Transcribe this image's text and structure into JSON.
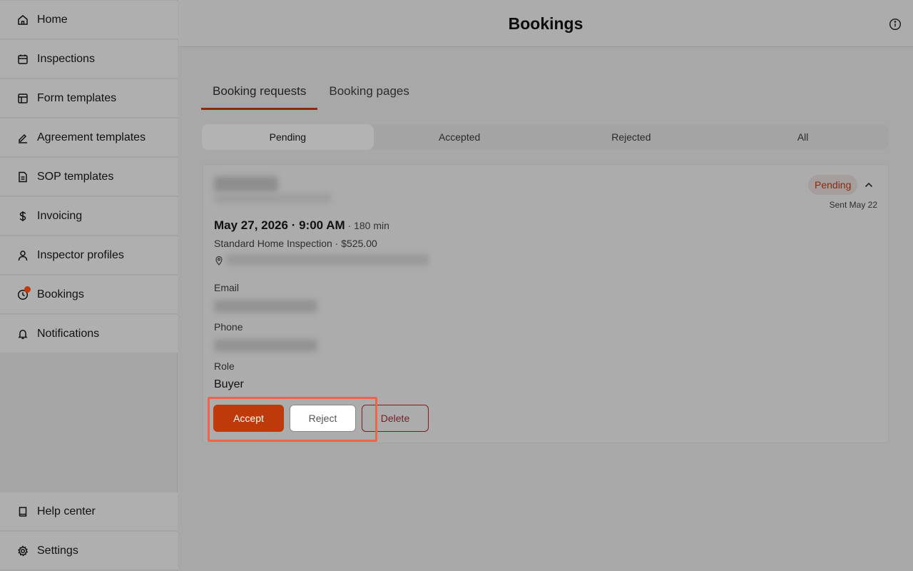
{
  "sidebar": {
    "items": [
      {
        "label": "Home",
        "icon": "home-icon"
      },
      {
        "label": "Inspections",
        "icon": "calendar-icon"
      },
      {
        "label": "Form templates",
        "icon": "layout-icon"
      },
      {
        "label": "Agreement templates",
        "icon": "signature-icon"
      },
      {
        "label": "SOP templates",
        "icon": "document-icon"
      },
      {
        "label": "Invoicing",
        "icon": "dollar-icon"
      },
      {
        "label": "Inspector profiles",
        "icon": "user-icon"
      },
      {
        "label": "Bookings",
        "icon": "clock-icon"
      },
      {
        "label": "Notifications",
        "icon": "bell-icon"
      }
    ],
    "bottom_items": [
      {
        "label": "Help center",
        "icon": "book-icon"
      },
      {
        "label": "Settings",
        "icon": "gear-icon"
      }
    ]
  },
  "header": {
    "title": "Bookings"
  },
  "tabs": [
    {
      "label": "Booking requests",
      "active": true
    },
    {
      "label": "Booking pages",
      "active": false
    }
  ],
  "filters": [
    {
      "label": "Pending",
      "active": true
    },
    {
      "label": "Accepted",
      "active": false
    },
    {
      "label": "Rejected",
      "active": false
    },
    {
      "label": "All",
      "active": false
    }
  ],
  "booking": {
    "status": "Pending",
    "sent": "Sent May 22",
    "datetime": "May 27, 2026 · 9:00 AM",
    "duration": " · 180 min",
    "service": "Standard Home Inspection · $525.00",
    "email_label": "Email",
    "phone_label": "Phone",
    "role_label": "Role",
    "role": "Buyer",
    "actions": {
      "accept": "Accept",
      "reject": "Reject",
      "delete": "Delete"
    }
  },
  "colors": {
    "accent": "#bf3a0a",
    "delete": "#7a1e26",
    "highlight": "#f0634a"
  }
}
